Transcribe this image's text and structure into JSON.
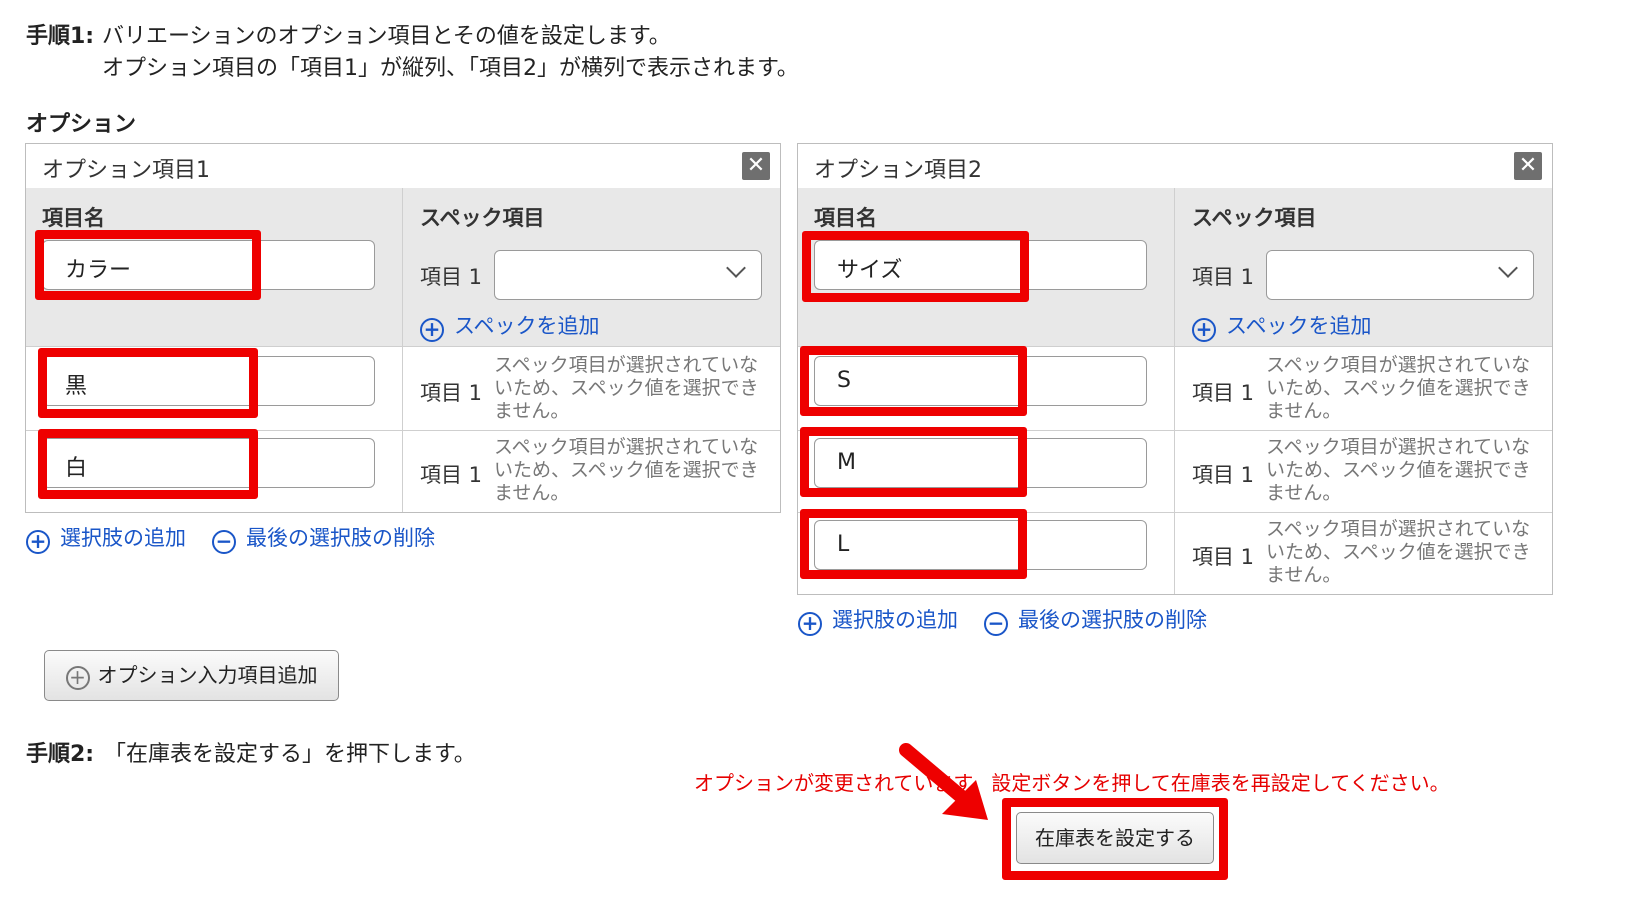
{
  "step1": {
    "label": "手順1:",
    "line1": "バリエーションのオプション項目とその値を設定します。",
    "line2": "オプション項目の「項目1」が縦列、「項目2」が横列で表示されます。"
  },
  "options_heading": "オプション",
  "panels": [
    {
      "title": "オプション項目1",
      "close": "✕",
      "col_name": "項目名",
      "col_spec": "スペック項目",
      "name_value": "カラー",
      "spec_label": "項目 1",
      "spec_select_value": "",
      "add_spec": "スペックを追加",
      "rows": [
        {
          "value": "黒",
          "spec_label": "項目 1",
          "note": "スペック項目が選択されていないため、スペック値を選択できません。"
        },
        {
          "value": "白",
          "spec_label": "項目 1",
          "note": "スペック項目が選択されていないため、スペック値を選択できません。"
        }
      ],
      "add_choice": "選択肢の追加",
      "remove_last": "最後の選択肢の削除"
    },
    {
      "title": "オプション項目2",
      "close": "✕",
      "col_name": "項目名",
      "col_spec": "スペック項目",
      "name_value": "サイズ",
      "spec_label": "項目 1",
      "spec_select_value": "",
      "add_spec": "スペックを追加",
      "rows": [
        {
          "value": "S",
          "spec_label": "項目 1",
          "note": "スペック項目が選択されていないため、スペック値を選択できません。"
        },
        {
          "value": "M",
          "spec_label": "項目 1",
          "note": "スペック項目が選択されていないため、スペック値を選択できません。"
        },
        {
          "value": "L",
          "spec_label": "項目 1",
          "note": "スペック項目が選択されていないため、スペック値を選択できません。"
        }
      ],
      "add_choice": "選択肢の追加",
      "remove_last": "最後の選択肢の削除"
    }
  ],
  "add_option_button": "オプション入力項目追加",
  "step2": {
    "label": "手順2:",
    "text": "「在庫表を設定する」を押下します。"
  },
  "warning": "オプションが変更されています。設定ボタンを押して在庫表を再設定してください。",
  "set_inventory_button": "在庫表を設定する",
  "colors": {
    "accent_link": "#1a56c8",
    "highlight": "#ee0000",
    "warning": "#e60000"
  },
  "icons": [
    "close-icon",
    "plus-circle-icon",
    "minus-circle-icon",
    "chevron-down-icon",
    "arrow-icon"
  ]
}
